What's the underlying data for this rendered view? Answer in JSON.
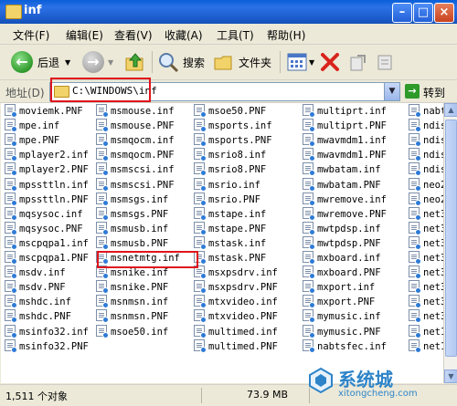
{
  "window": {
    "title": "inf"
  },
  "menu": [
    "文件(F)",
    "编辑(E)",
    "查看(V)",
    "收藏(A)",
    "工具(T)",
    "帮助(H)"
  ],
  "toolbar": {
    "back": "后退",
    "search": "搜索",
    "folders": "文件夹"
  },
  "address": {
    "label": "地址(D)",
    "path": "C:\\WINDOWS\\inf",
    "go": "转到"
  },
  "columns": [
    [
      "moviemk.PNF",
      "mpe.inf",
      "mpe.PNF",
      "mplayer2.inf",
      "mplayer2.PNF",
      "mpssttln.inf",
      "mpssttln.PNF",
      "mqsysoc.inf",
      "mqsysoc.PNF",
      "mscpqpa1.inf",
      "mscpqpa1.PNF",
      "msdv.inf",
      "msdv.PNF",
      "mshdc.inf",
      "mshdc.PNF",
      "msinfo32.inf",
      "msinfo32.PNF"
    ],
    [
      "msmouse.inf",
      "msmouse.PNF",
      "msmqocm.inf",
      "msmqocm.PNF",
      "msmscsi.inf",
      "msmscsi.PNF",
      "msmsgs.inf",
      "msmsgs.PNF",
      "msmusb.inf",
      "msmusb.PNF",
      "msnetmtg.inf",
      "msnike.inf",
      "msnike.PNF",
      "msnmsn.inf",
      "msnmsn.PNF",
      "msoe50.inf"
    ],
    [
      "msoe50.PNF",
      "msports.inf",
      "msports.PNF",
      "msrio8.inf",
      "msrio8.PNF",
      "msrio.inf",
      "msrio.PNF",
      "mstape.inf",
      "mstape.PNF",
      "mstask.inf",
      "mstask.PNF",
      "msxpsdrv.inf",
      "msxpsdrv.PNF",
      "mtxvideo.inf",
      "mtxvideo.PNF",
      "multimed.inf",
      "multimed.PNF"
    ],
    [
      "multiprt.inf",
      "multiprt.PNF",
      "mwavmdm1.inf",
      "mwavmdm1.PNF",
      "mwbatam.inf",
      "mwbatam.PNF",
      "mwremove.inf",
      "mwremove.PNF",
      "mwtpdsp.inf",
      "mwtpdsp.PNF",
      "mxboard.inf",
      "mxboard.PNF",
      "mxport.inf",
      "mxport.PNF",
      "mymusic.inf",
      "mymusic.PNF",
      "nabtsfec.inf"
    ],
    [
      "nabtsfe",
      "ndisip.",
      "ndisip.",
      "ndisuio",
      "ndisuio",
      "neo20xx",
      "neo20xx",
      "net3c55",
      "net3c55",
      "net3c58",
      "net3c58",
      "net3c98",
      "net3c98",
      "net3sr.",
      "net3sr.",
      "net10.i",
      "net10.P"
    ]
  ],
  "status": {
    "count": "1,511 个对象",
    "size": "73.9 MB"
  },
  "watermark": {
    "brand": "系统城",
    "url": "xitongcheng.com"
  },
  "colors": {
    "highlight_box": "#E0141C",
    "titlebar": "#1E5FD0"
  }
}
